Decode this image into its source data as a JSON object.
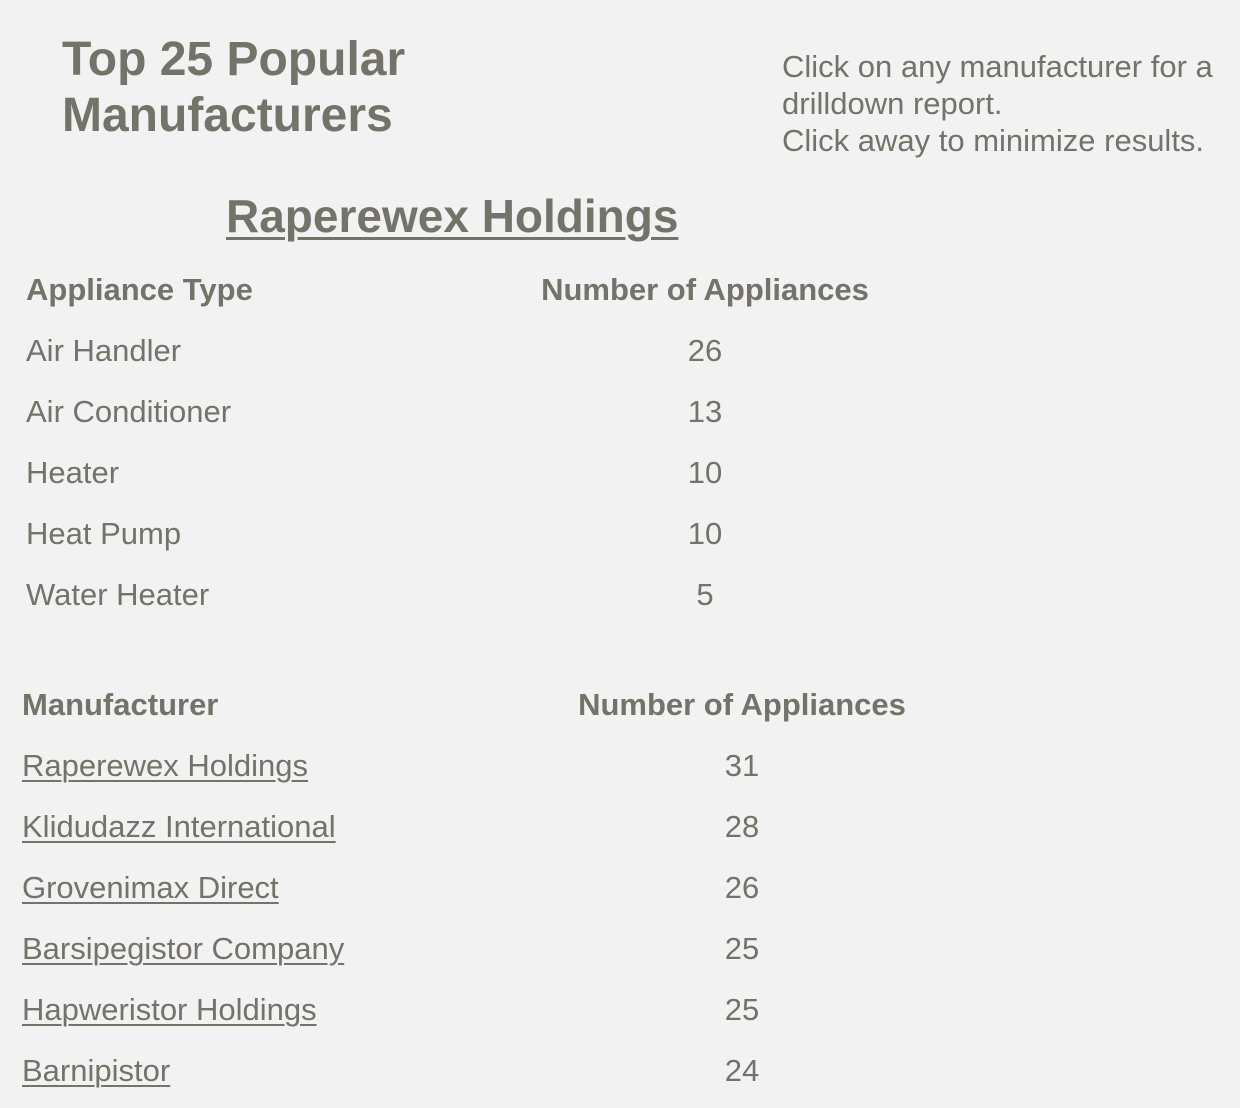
{
  "header": {
    "title": "Top 25 Popular Manufacturers",
    "instructions": [
      "Click on any manufacturer for a",
      "drilldown report.",
      "Click away to minimize results."
    ]
  },
  "drilldown": {
    "title": "Raperewex Holdings",
    "columns": [
      "Appliance Type",
      "Number of Appliances"
    ],
    "rows": [
      {
        "type": "Air Handler",
        "count": "26"
      },
      {
        "type": "Air Conditioner",
        "count": "13"
      },
      {
        "type": "Heater",
        "count": "10"
      },
      {
        "type": "Heat Pump",
        "count": "10"
      },
      {
        "type": "Water Heater",
        "count": "5"
      }
    ]
  },
  "manufacturers": {
    "columns": [
      "Manufacturer",
      "Number of Appliances"
    ],
    "rows": [
      {
        "name": "Raperewex Holdings",
        "count": "31"
      },
      {
        "name": "Klidudazz International",
        "count": "28"
      },
      {
        "name": "Grovenimax Direct",
        "count": "26"
      },
      {
        "name": "Barsipegistor Company",
        "count": "25"
      },
      {
        "name": "Hapweristor Holdings",
        "count": "25"
      },
      {
        "name": "Barnipistor",
        "count": "24"
      }
    ]
  }
}
